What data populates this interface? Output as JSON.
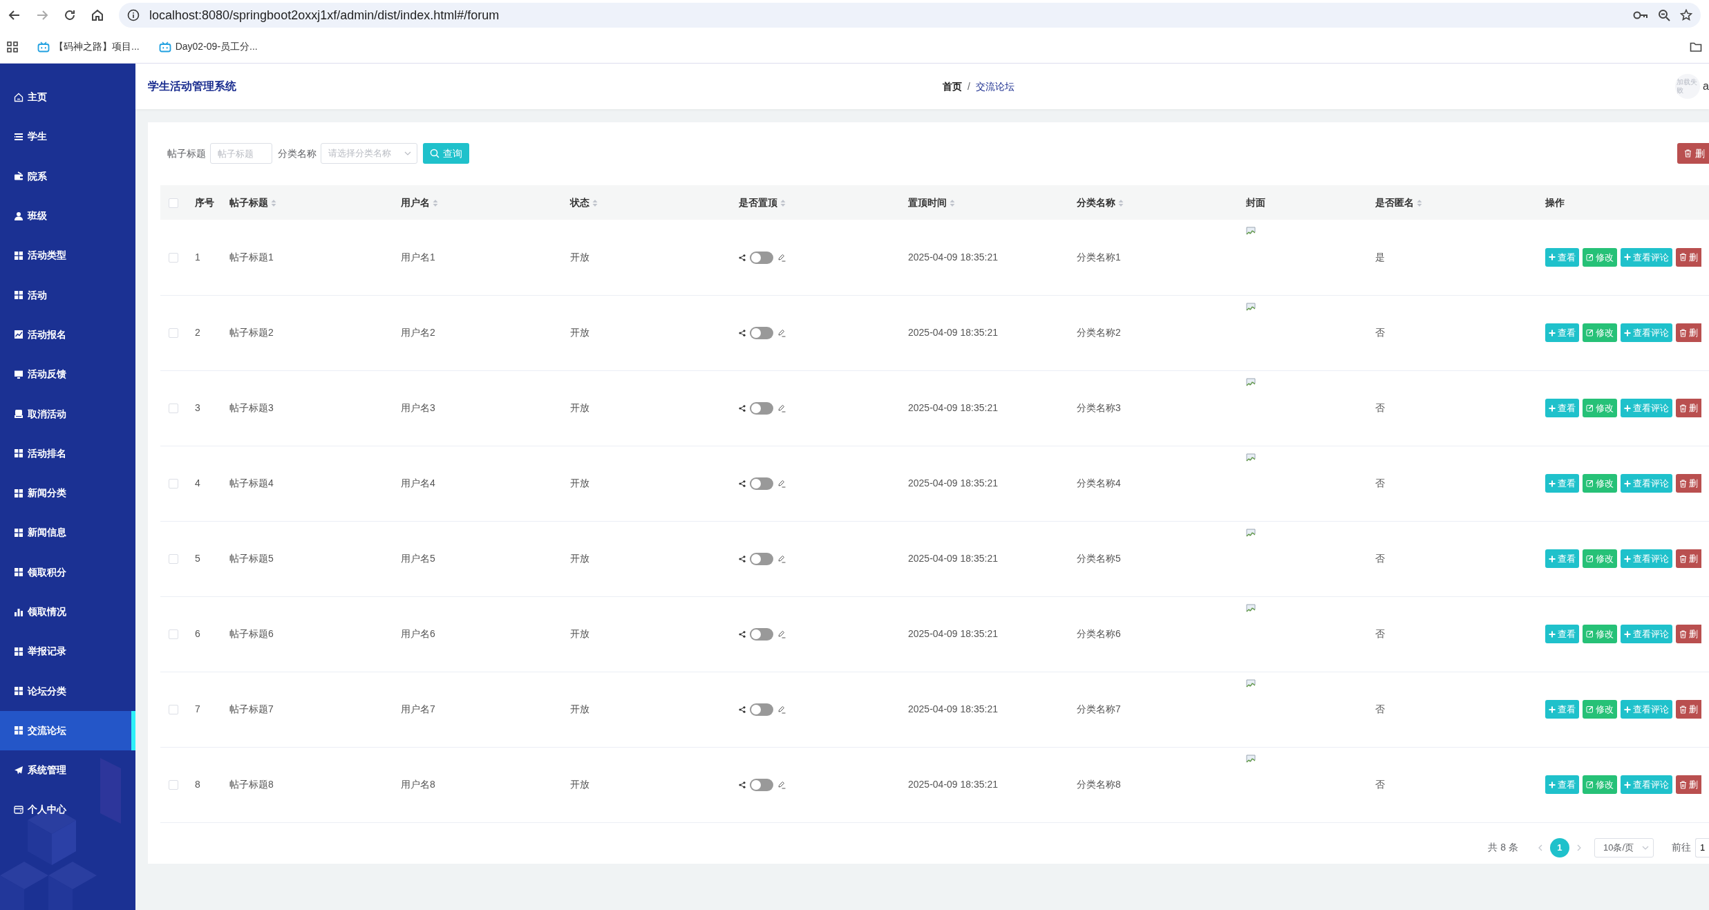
{
  "browser": {
    "url": "localhost:8080/springboot2oxxj1xf/admin/dist/index.html#/forum",
    "bookmarks": [
      {
        "label": "【码神之路】项目..."
      },
      {
        "label": "Day02-09-员工分..."
      }
    ]
  },
  "sidebar": {
    "items": [
      {
        "label": "主页",
        "selected": false
      },
      {
        "label": "学生",
        "selected": false
      },
      {
        "label": "院系",
        "selected": false
      },
      {
        "label": "班级",
        "selected": false
      },
      {
        "label": "活动类型",
        "selected": false
      },
      {
        "label": "活动",
        "selected": false
      },
      {
        "label": "活动报名",
        "selected": false
      },
      {
        "label": "活动反馈",
        "selected": false
      },
      {
        "label": "取消活动",
        "selected": false
      },
      {
        "label": "活动排名",
        "selected": false
      },
      {
        "label": "新闻分类",
        "selected": false
      },
      {
        "label": "新闻信息",
        "selected": false
      },
      {
        "label": "领取积分",
        "selected": false
      },
      {
        "label": "领取情况",
        "selected": false
      },
      {
        "label": "举报记录",
        "selected": false
      },
      {
        "label": "论坛分类",
        "selected": false
      },
      {
        "label": "交流论坛",
        "selected": true
      },
      {
        "label": "系统管理",
        "selected": false
      },
      {
        "label": "个人中心",
        "selected": false
      }
    ]
  },
  "header": {
    "title": "学生活动管理系统",
    "breadcrumb": [
      "首页",
      "交流论坛"
    ],
    "breadcrumb_separator": "/",
    "avatar_alt": "加载失败",
    "username": "a"
  },
  "search": {
    "fields": [
      {
        "label": "帖子标题",
        "kind": "input",
        "placeholder": "帖子标题"
      },
      {
        "label": "分类名称",
        "kind": "select",
        "placeholder": "请选择分类名称"
      }
    ],
    "search_button": "查询",
    "delete_button": "删"
  },
  "table": {
    "header_checked": false,
    "columns": [
      {
        "label": "序号",
        "sortable": false
      },
      {
        "label": "帖子标题",
        "sortable": true
      },
      {
        "label": "用户名",
        "sortable": true
      },
      {
        "label": "状态",
        "sortable": true
      },
      {
        "label": "是否置顶",
        "sortable": true
      },
      {
        "label": "置顶时间",
        "sortable": true
      },
      {
        "label": "分类名称",
        "sortable": true
      },
      {
        "label": "封面",
        "sortable": false
      },
      {
        "label": "是否匿名",
        "sortable": true
      },
      {
        "label": "操作",
        "sortable": false
      }
    ],
    "rows": [
      {
        "checked": false,
        "index": "1",
        "title": "帖子标题1",
        "user": "用户名1",
        "status": "开放",
        "pinned": false,
        "pinned_time": "2025-04-09 18:35:21",
        "category": "分类名称1",
        "anonymous": "是",
        "actions": [
          {
            "label": "查看",
            "kind": "view"
          },
          {
            "label": "修改",
            "kind": "edit"
          },
          {
            "label": "查看评论",
            "kind": "view"
          },
          {
            "label": "删",
            "kind": "delete"
          }
        ]
      },
      {
        "checked": false,
        "index": "2",
        "title": "帖子标题2",
        "user": "用户名2",
        "status": "开放",
        "pinned": false,
        "pinned_time": "2025-04-09 18:35:21",
        "category": "分类名称2",
        "anonymous": "否",
        "actions": [
          {
            "label": "查看",
            "kind": "view"
          },
          {
            "label": "修改",
            "kind": "edit"
          },
          {
            "label": "查看评论",
            "kind": "view"
          },
          {
            "label": "删",
            "kind": "delete"
          }
        ]
      },
      {
        "checked": false,
        "index": "3",
        "title": "帖子标题3",
        "user": "用户名3",
        "status": "开放",
        "pinned": false,
        "pinned_time": "2025-04-09 18:35:21",
        "category": "分类名称3",
        "anonymous": "否",
        "actions": [
          {
            "label": "查看",
            "kind": "view"
          },
          {
            "label": "修改",
            "kind": "edit"
          },
          {
            "label": "查看评论",
            "kind": "view"
          },
          {
            "label": "删",
            "kind": "delete"
          }
        ]
      },
      {
        "checked": false,
        "index": "4",
        "title": "帖子标题4",
        "user": "用户名4",
        "status": "开放",
        "pinned": false,
        "pinned_time": "2025-04-09 18:35:21",
        "category": "分类名称4",
        "anonymous": "否",
        "actions": [
          {
            "label": "查看",
            "kind": "view"
          },
          {
            "label": "修改",
            "kind": "edit"
          },
          {
            "label": "查看评论",
            "kind": "view"
          },
          {
            "label": "删",
            "kind": "delete"
          }
        ]
      },
      {
        "checked": false,
        "index": "5",
        "title": "帖子标题5",
        "user": "用户名5",
        "status": "开放",
        "pinned": false,
        "pinned_time": "2025-04-09 18:35:21",
        "category": "分类名称5",
        "anonymous": "否",
        "actions": [
          {
            "label": "查看",
            "kind": "view"
          },
          {
            "label": "修改",
            "kind": "edit"
          },
          {
            "label": "查看评论",
            "kind": "view"
          },
          {
            "label": "删",
            "kind": "delete"
          }
        ]
      },
      {
        "checked": false,
        "index": "6",
        "title": "帖子标题6",
        "user": "用户名6",
        "status": "开放",
        "pinned": false,
        "pinned_time": "2025-04-09 18:35:21",
        "category": "分类名称6",
        "anonymous": "否",
        "actions": [
          {
            "label": "查看",
            "kind": "view"
          },
          {
            "label": "修改",
            "kind": "edit"
          },
          {
            "label": "查看评论",
            "kind": "view"
          },
          {
            "label": "删",
            "kind": "delete"
          }
        ]
      },
      {
        "checked": false,
        "index": "7",
        "title": "帖子标题7",
        "user": "用户名7",
        "status": "开放",
        "pinned": false,
        "pinned_time": "2025-04-09 18:35:21",
        "category": "分类名称7",
        "anonymous": "否",
        "actions": [
          {
            "label": "查看",
            "kind": "view"
          },
          {
            "label": "修改",
            "kind": "edit"
          },
          {
            "label": "查看评论",
            "kind": "view"
          },
          {
            "label": "删",
            "kind": "delete"
          }
        ]
      },
      {
        "checked": false,
        "index": "8",
        "title": "帖子标题8",
        "user": "用户名8",
        "status": "开放",
        "pinned": false,
        "pinned_time": "2025-04-09 18:35:21",
        "category": "分类名称8",
        "anonymous": "否",
        "actions": [
          {
            "label": "查看",
            "kind": "view"
          },
          {
            "label": "修改",
            "kind": "edit"
          },
          {
            "label": "查看评论",
            "kind": "view"
          },
          {
            "label": "删",
            "kind": "delete"
          }
        ]
      }
    ]
  },
  "pagination": {
    "total": "共 8 条",
    "pages": [
      {
        "label": "1",
        "selected": true
      }
    ],
    "page_size": "10条/页",
    "goto_label": "前往",
    "goto_value": "1"
  }
}
